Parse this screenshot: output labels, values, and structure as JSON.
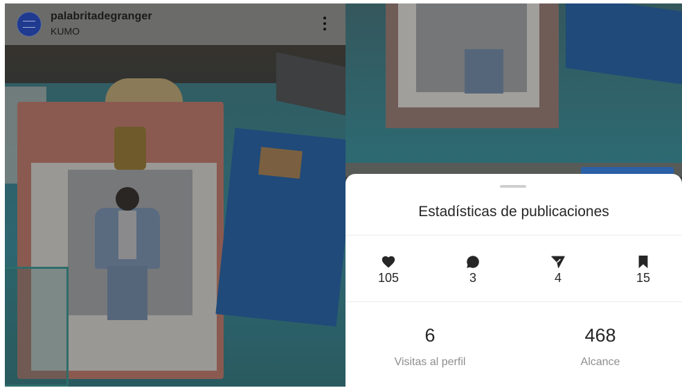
{
  "post": {
    "username": "palabritadegranger",
    "location": "KUMO",
    "more_icon": "more-vertical-icon"
  },
  "insights": {
    "title": "Estadísticas de publicaciones",
    "interactions": [
      {
        "icon": "heart-icon",
        "value": "105"
      },
      {
        "icon": "comment-icon",
        "value": "3"
      },
      {
        "icon": "send-icon",
        "value": "4"
      },
      {
        "icon": "bookmark-icon",
        "value": "15"
      }
    ],
    "profile_visits": {
      "value": "6",
      "label": "Visitas al perfil"
    },
    "reach": {
      "value": "468",
      "label": "Alcance"
    }
  },
  "colors": {
    "dim_overlay": "#6b6b69",
    "sheet_bg": "#ffffff",
    "text_primary": "#262626",
    "text_secondary": "#8e8e8e"
  }
}
